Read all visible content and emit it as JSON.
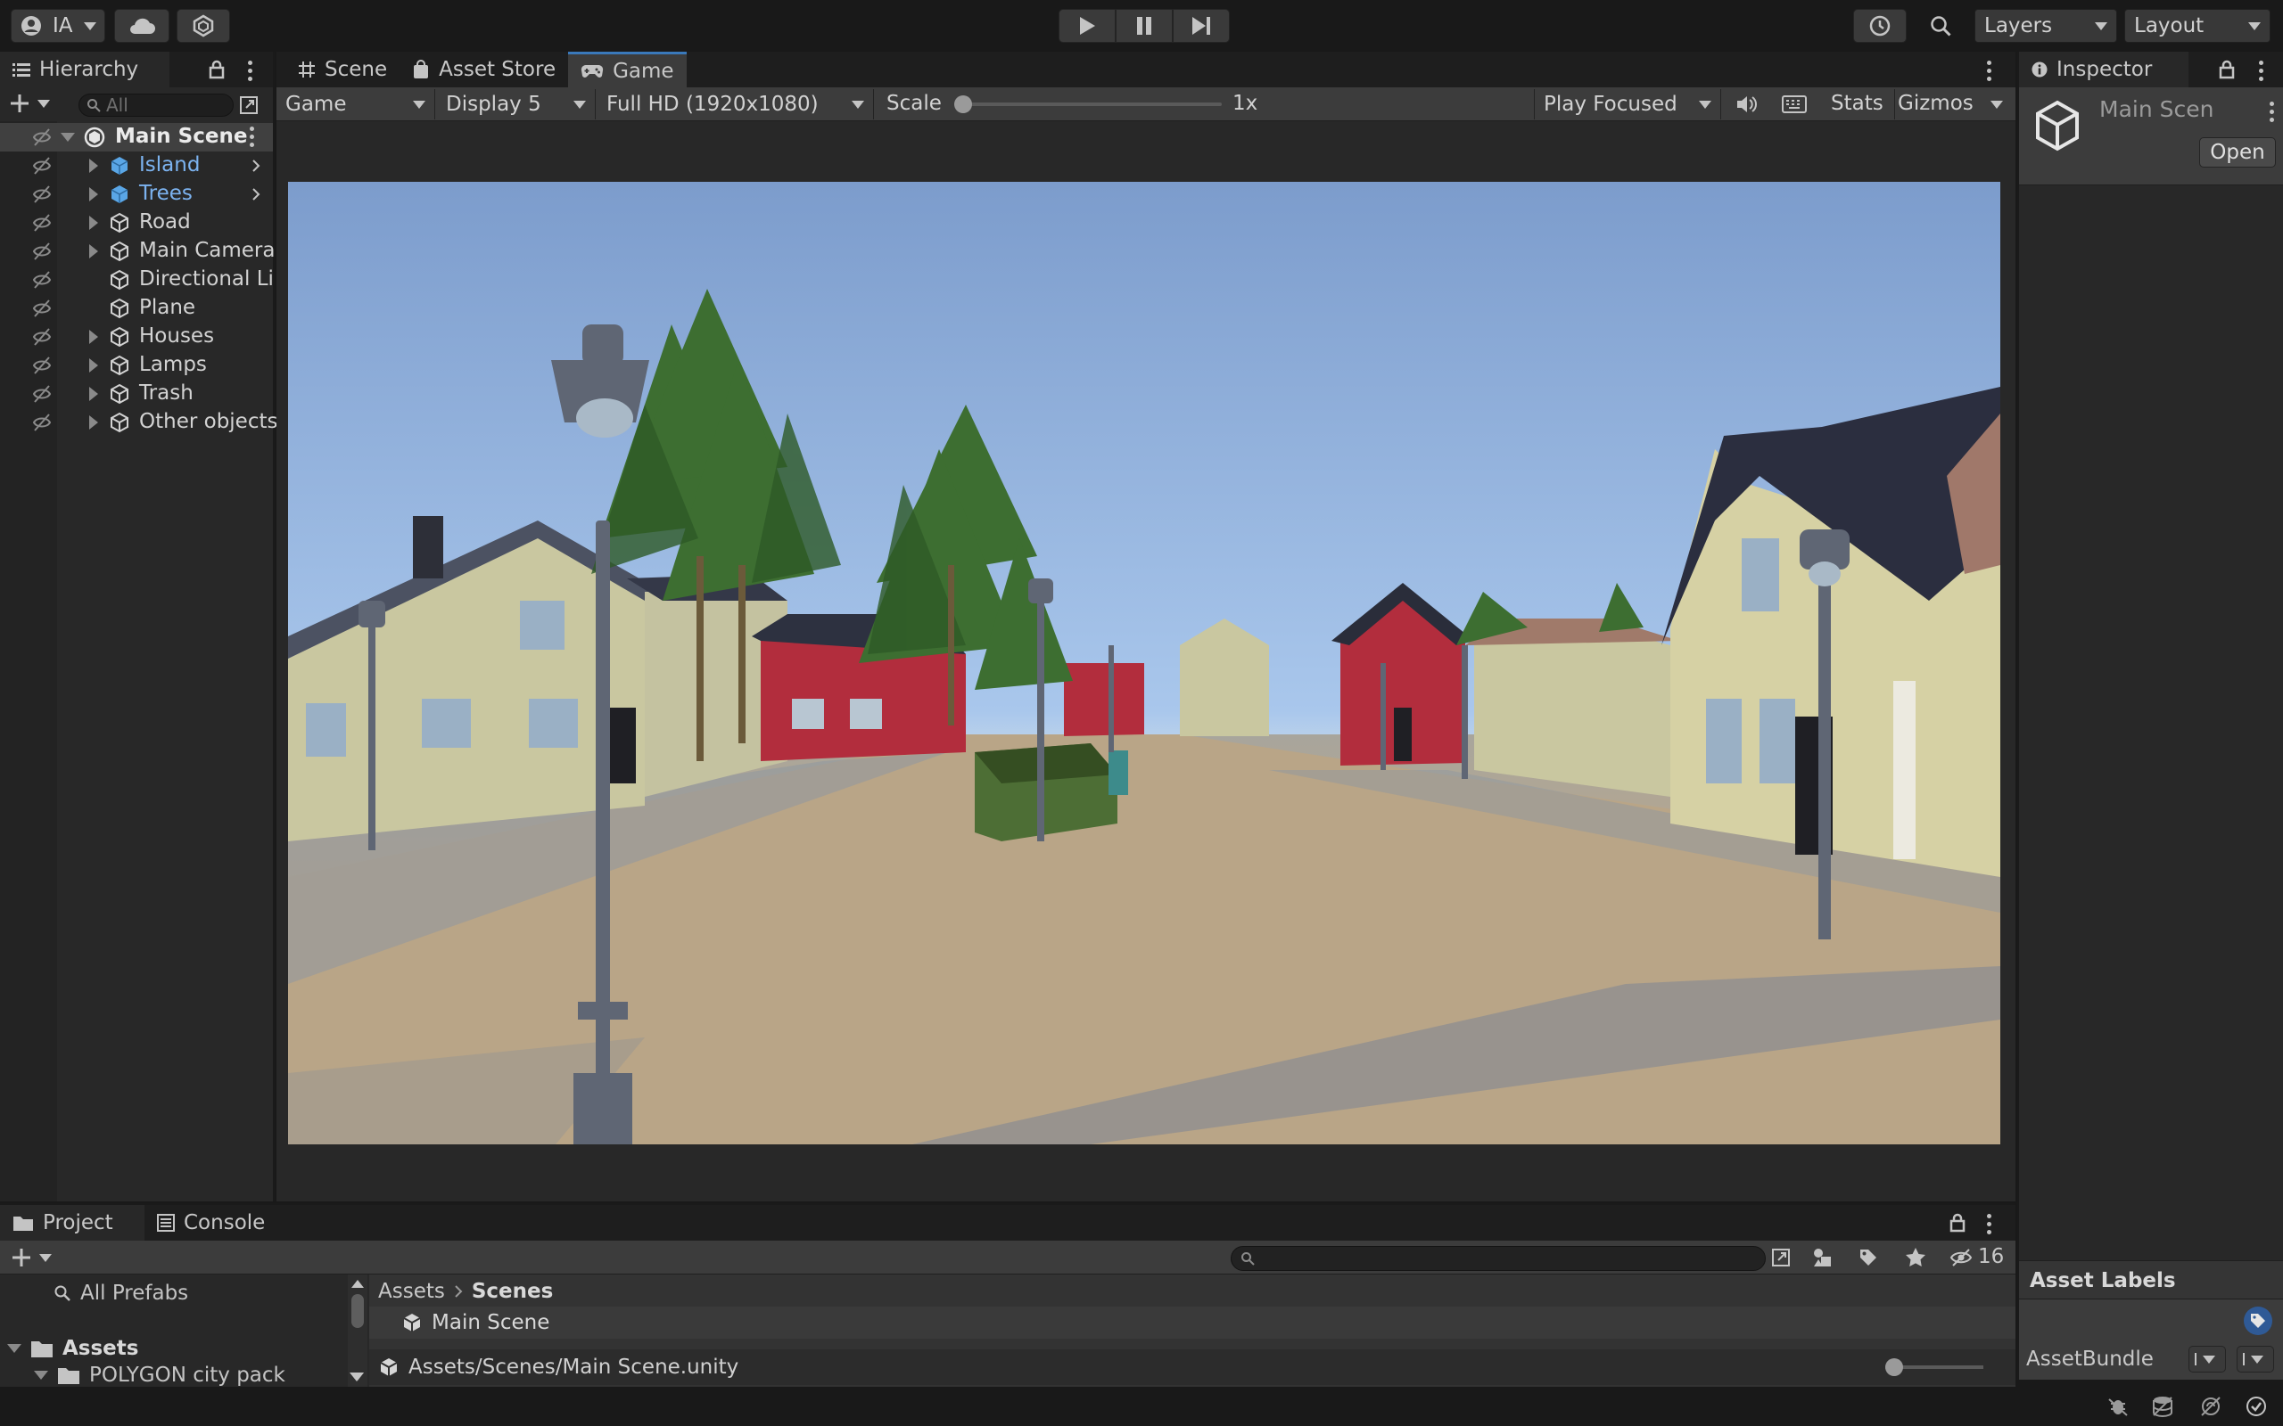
{
  "toolbar": {
    "account_label": "IA",
    "layers_label": "Layers",
    "layout_label": "Layout"
  },
  "hierarchy": {
    "tab_label": "Hierarchy",
    "search_placeholder": "All",
    "root": "Main Scene",
    "items": [
      {
        "label": "Island",
        "prefab": true,
        "expandable": true
      },
      {
        "label": "Trees",
        "prefab": true,
        "expandable": true
      },
      {
        "label": "Road",
        "prefab": false,
        "expandable": true
      },
      {
        "label": "Main Camera",
        "prefab": false,
        "expandable": true
      },
      {
        "label": "Directional Li",
        "prefab": false,
        "expandable": false
      },
      {
        "label": "Plane",
        "prefab": false,
        "expandable": false
      },
      {
        "label": "Houses",
        "prefab": false,
        "expandable": true
      },
      {
        "label": "Lamps",
        "prefab": false,
        "expandable": true
      },
      {
        "label": "Trash",
        "prefab": false,
        "expandable": true
      },
      {
        "label": "Other objects",
        "prefab": false,
        "expandable": true
      }
    ]
  },
  "center_tabs": {
    "scene": "Scene",
    "asset_store": "Asset Store",
    "game": "Game"
  },
  "game_bar": {
    "view_mode": "Game",
    "display": "Display 5",
    "resolution": "Full HD (1920x1080)",
    "scale_label": "Scale",
    "scale_value": "1x",
    "scale_level": 0,
    "play_mode": "Play Focused",
    "stats": "Stats",
    "gizmos": "Gizmos"
  },
  "inspector": {
    "tab_label": "Inspector",
    "object_name": "Main Scen",
    "open_button": "Open",
    "asset_labels": "Asset Labels",
    "asset_bundle": "AssetBundle"
  },
  "bottom": {
    "project_tab": "Project",
    "console_tab": "Console",
    "hidden_count": "16",
    "favorites": "All Prefabs",
    "assets_root": "Assets",
    "assets_child": "POLYGON city pack",
    "breadcrumb_root": "Assets",
    "breadcrumb_current": "Scenes",
    "file_item": "Main Scene",
    "path": "Assets/Scenes/Main Scene.unity"
  },
  "colors": {
    "accent": "#3a79bb",
    "prefab_text": "#7cb3f0",
    "panel_bg": "#282828",
    "toolbar_bg": "#191919"
  }
}
